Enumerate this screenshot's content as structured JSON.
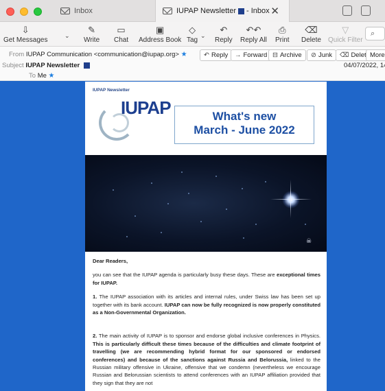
{
  "tabs": {
    "inbox_label": "Inbox",
    "active_label_prefix": "IUPAP Newsletter",
    "active_label_suffix": "- Inbox"
  },
  "toolbar": {
    "get_messages": "Get Messages",
    "write": "Write",
    "chat": "Chat",
    "address_book": "Address Book",
    "tag": "Tag",
    "reply": "Reply",
    "reply_all": "Reply All",
    "print": "Print",
    "delete": "Delete",
    "quick_filter": "Quick Filter"
  },
  "header": {
    "from_label": "From",
    "from_value": "IUPAP Communication <communication@iupap.org>",
    "subject_label": "Subject",
    "subject_value": "IUPAP Newsletter",
    "to_label": "To",
    "to_value": "Me",
    "date": "04/07/2022, 14",
    "buttons": {
      "reply": "Reply",
      "forward": "Forward",
      "archive": "Archive",
      "junk": "Junk",
      "delete": "Delete",
      "more": "More"
    }
  },
  "newsletter": {
    "title": "IUPAP Newsletter",
    "logo_text": "IUPAP",
    "banner_line1": "What's new",
    "banner_line2": "March - June 2022",
    "image_credit": "☠",
    "greeting": "Dear Readers,",
    "p1_a": "you can see that the IUPAP agenda is particularly busy these days. These are ",
    "p1_b": "exceptional times for IUPAP.",
    "p2_num": "1.",
    "p2_a": " The IUPAP association with its articles and internal rules, under Swiss law has been set up together with its bank account. ",
    "p2_b": "IUPAP can now be fully recognized is now properly constituted as a Non-Governmental Organization.",
    "p3_num": "2.",
    "p3_a": " The main activity of IUPAP is to sponsor and endorse global inclusive conferences in Physics. ",
    "p3_b": "This is particularly difficult these times because of the difficulties and climate footprint of travelling (we are recommending hybrid format for our sponsored or endorsed conferences) and because of the sanctions against Russia and Belorussia,",
    "p3_c": " linked to the Russian military offensive in Ukraine, offensive that we condemn (nevertheless we encourage Russian and Belorussian scientists to attend conferences with an IUPAP affiliation provided that they sign that they are not"
  },
  "colors": {
    "body_background": "#1f66c9",
    "accent": "#1d4fa3",
    "star": "#1e7fe0"
  }
}
